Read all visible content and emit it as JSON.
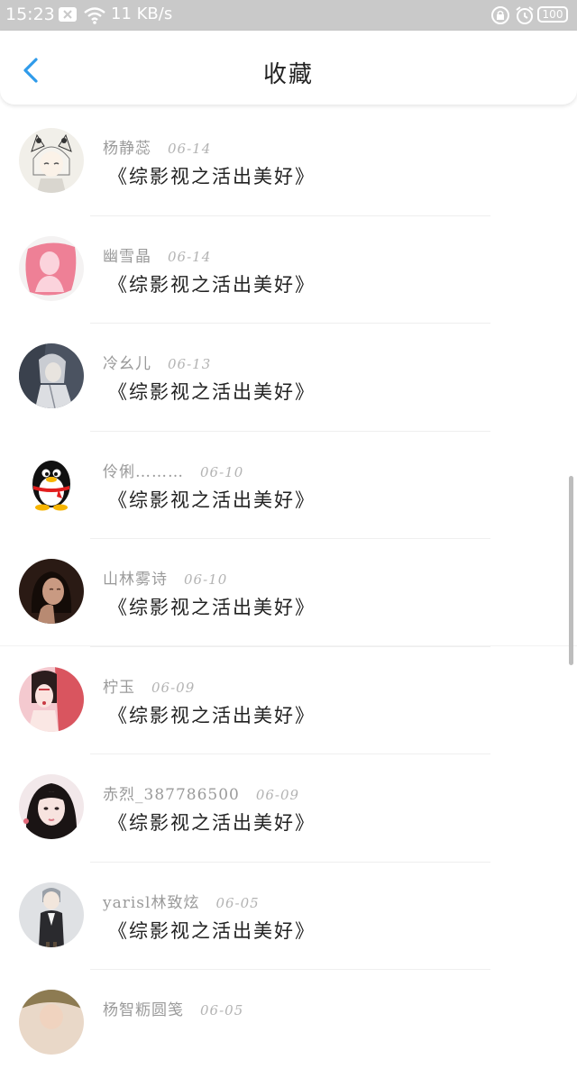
{
  "status_bar": {
    "time": "15:23",
    "speed": "11 KB/s",
    "battery": "100",
    "icons": [
      "close-box-icon",
      "wifi-icon",
      "lock-icon",
      "alarm-icon",
      "battery-icon"
    ]
  },
  "header": {
    "title": "收藏",
    "back_icon": "chevron-left-icon",
    "accent": "#2f9bea"
  },
  "items": [
    {
      "user": "杨静蕊",
      "date": "06-14",
      "title": "《综影视之活出美好》",
      "avatar": "avatar-white-haired-cat-eared-girl"
    },
    {
      "user": "幽雪晶",
      "date": "06-14",
      "title": "《综影视之活出美好》",
      "avatar": "avatar-pink-silhouette"
    },
    {
      "user": "冷幺儿",
      "date": "06-13",
      "title": "《综影视之活出美好》",
      "avatar": "avatar-grey-haired-character"
    },
    {
      "user": "伶俐………",
      "date": "06-10",
      "title": "《综影视之活出美好》",
      "avatar": "avatar-qq-penguin"
    },
    {
      "user": "山林雾诗",
      "date": "06-10",
      "title": "《综影视之活出美好》",
      "avatar": "avatar-dark-portrait"
    },
    {
      "user": "柠玉",
      "date": "06-09",
      "title": "《综影视之活出美好》",
      "avatar": "avatar-red-costume-portrait"
    },
    {
      "user": "赤烈_387786500",
      "date": "06-09",
      "title": "《综影视之活出美好》",
      "avatar": "avatar-girl-portrait"
    },
    {
      "user": "yarisl林致炫",
      "date": "06-05",
      "title": "《综影视之活出美好》",
      "avatar": "avatar-suit-character"
    },
    {
      "user": "杨智粝圆笺",
      "date": "06-05",
      "title": "",
      "avatar": "avatar-partial-portrait"
    }
  ]
}
